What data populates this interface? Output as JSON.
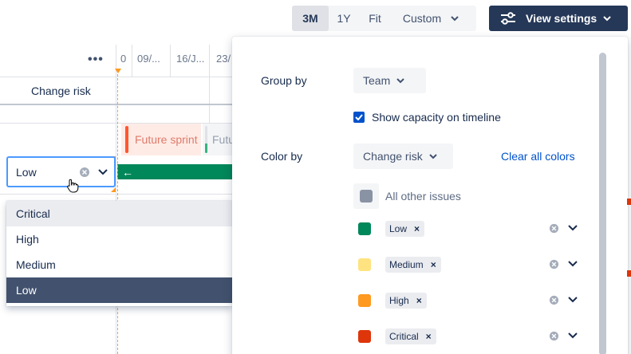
{
  "toolbar": {
    "range_options": [
      "3M",
      "1Y",
      "Fit",
      "Custom"
    ],
    "active_range": "3M",
    "view_settings_label": "View settings"
  },
  "timeline": {
    "dates": [
      "0",
      "09/...",
      "16/J...",
      "23/"
    ],
    "column_title": "Change risk",
    "sprint_label": "Future sprint",
    "sprint_label_truncated": "Futu",
    "bar_arrow": "←"
  },
  "field": {
    "value": "Low",
    "options": [
      "Critical",
      "High",
      "Medium",
      "Low"
    ],
    "hovered": "Critical",
    "selected": "Low"
  },
  "panel": {
    "group_by_label": "Group by",
    "group_by_value": "Team",
    "show_capacity_label": "Show capacity on timeline",
    "show_capacity_checked": true,
    "color_by_label": "Color by",
    "color_by_value": "Change risk",
    "clear_all_label": "Clear all colors",
    "other_issues_label": "All other issues",
    "other_issues_color": "#8993a4",
    "rules": [
      {
        "label": "Low",
        "color": "#00875a"
      },
      {
        "label": "Medium",
        "color": "#ffe380"
      },
      {
        "label": "High",
        "color": "#ff991f"
      },
      {
        "label": "Critical",
        "color": "#de350b"
      }
    ]
  }
}
